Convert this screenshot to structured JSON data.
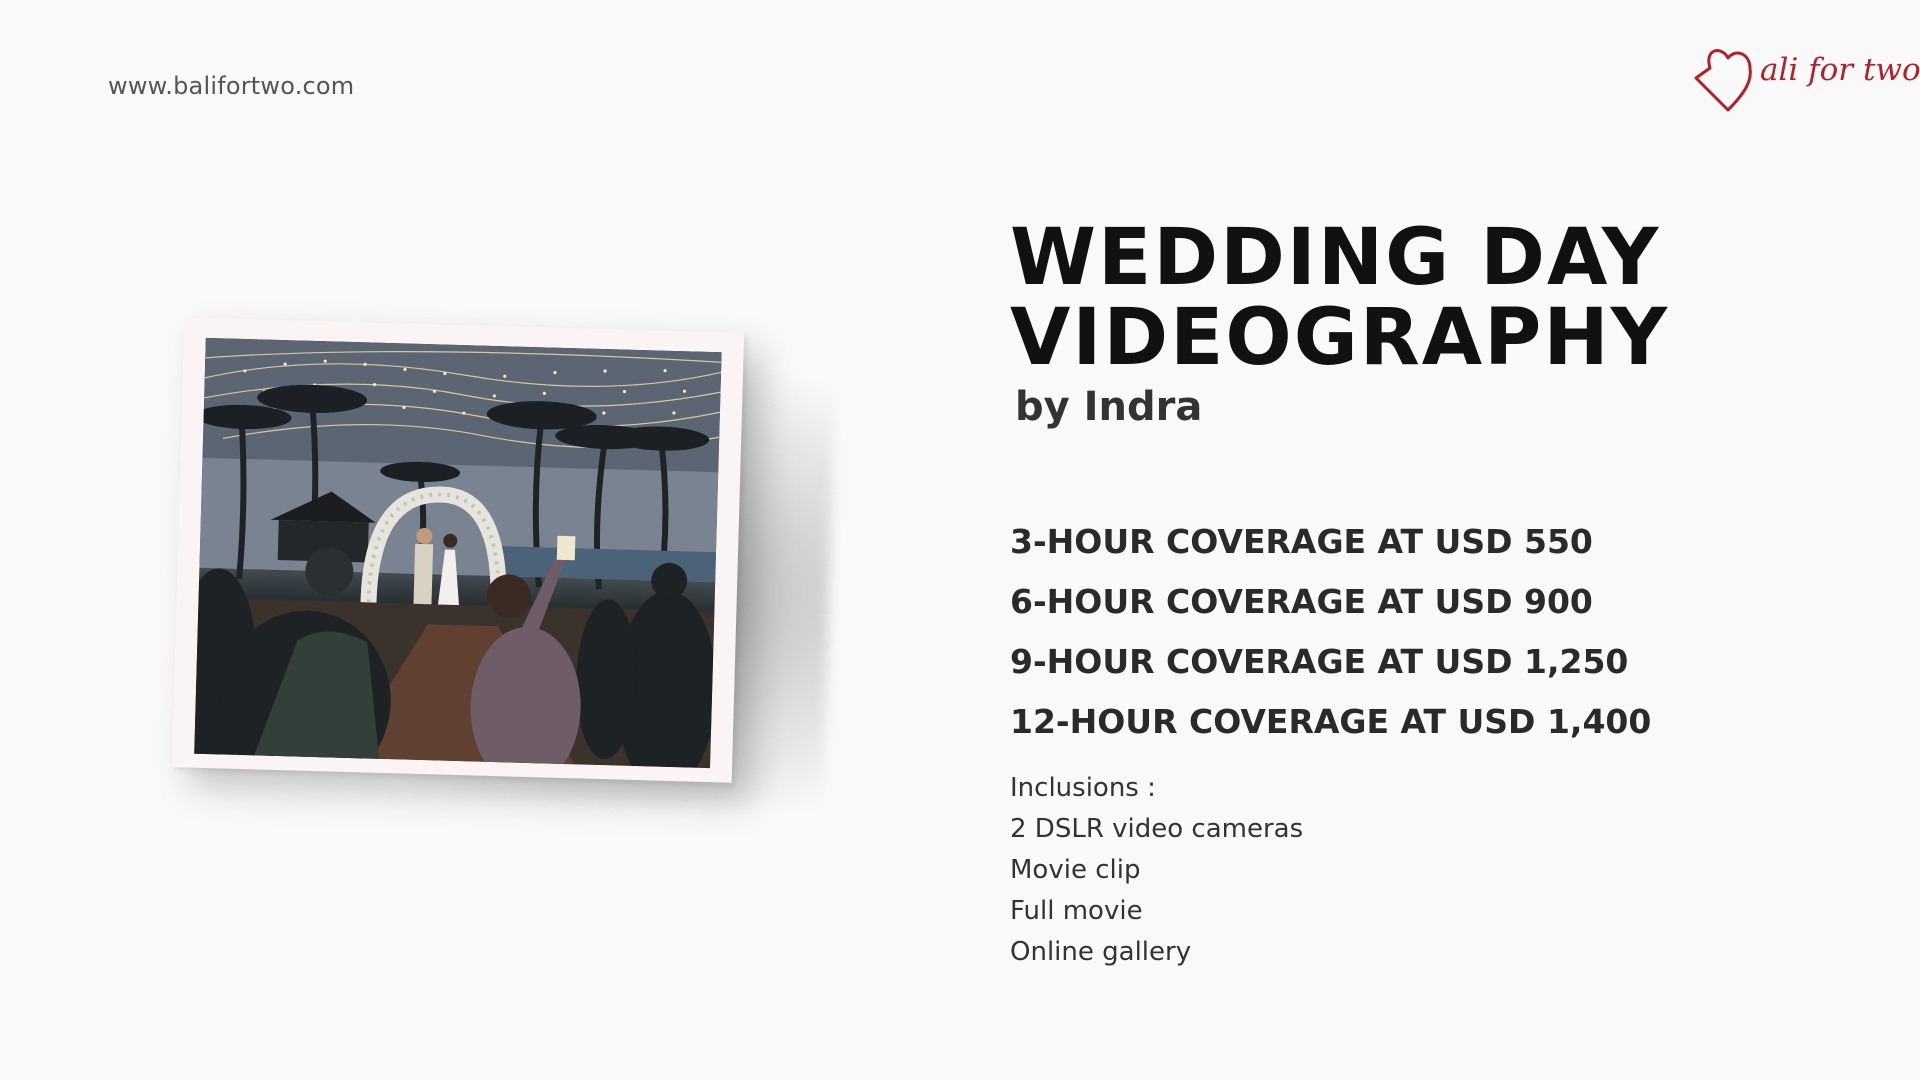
{
  "header": {
    "website": "www.balifortwo.com",
    "logo_text": "ali for two",
    "logo_color": "#b3202a"
  },
  "photo": {
    "description_icon": "wedding-ceremony-photo"
  },
  "title": {
    "line1": "WEDDING DAY",
    "line2": "VIDEOGRAPHY",
    "subtitle": "by Indra"
  },
  "pricing": [
    "3-HOUR COVERAGE AT USD 550",
    "6-HOUR COVERAGE AT USD 900",
    "9-HOUR COVERAGE AT USD 1,250",
    "12-HOUR COVERAGE AT USD 1,400"
  ],
  "inclusions": {
    "title": "Inclusions :",
    "items": [
      "2 DSLR video cameras",
      "Movie clip",
      "Full movie",
      "Online gallery"
    ]
  }
}
